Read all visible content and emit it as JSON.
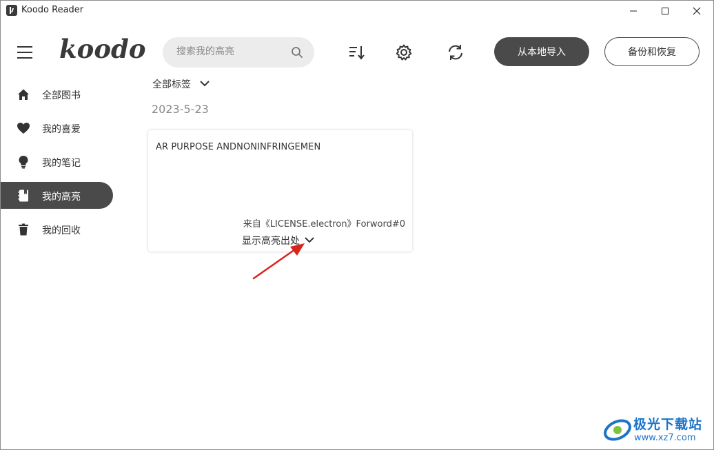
{
  "window": {
    "title": "Koodo Reader"
  },
  "header": {
    "logo": "koodo",
    "search_placeholder": "搜索我的高亮",
    "import_label": "从本地导入",
    "backup_label": "备份和恢复"
  },
  "sidebar": {
    "items": [
      {
        "label": "全部图书",
        "icon": "home-icon"
      },
      {
        "label": "我的喜爱",
        "icon": "heart-icon"
      },
      {
        "label": "我的笔记",
        "icon": "lightbulb-icon"
      },
      {
        "label": "我的高亮",
        "icon": "highlight-notebook-icon",
        "active": true
      },
      {
        "label": "我的回收",
        "icon": "trash-icon"
      }
    ]
  },
  "main": {
    "tag_filter": "全部标签",
    "date": "2023-5-23",
    "card": {
      "text": "AR PURPOSE ANDNONINFRINGEMEN",
      "source": "来自《LICENSE.electron》Forword#0",
      "toggle_label": "显示高亮出处"
    }
  },
  "watermark": {
    "name": "极光下载站",
    "url": "www.xz7.com"
  },
  "colors": {
    "accent_dark": "#4a4a4a",
    "arrow_red": "#d9241c",
    "watermark_blue": "#1c74c9"
  }
}
